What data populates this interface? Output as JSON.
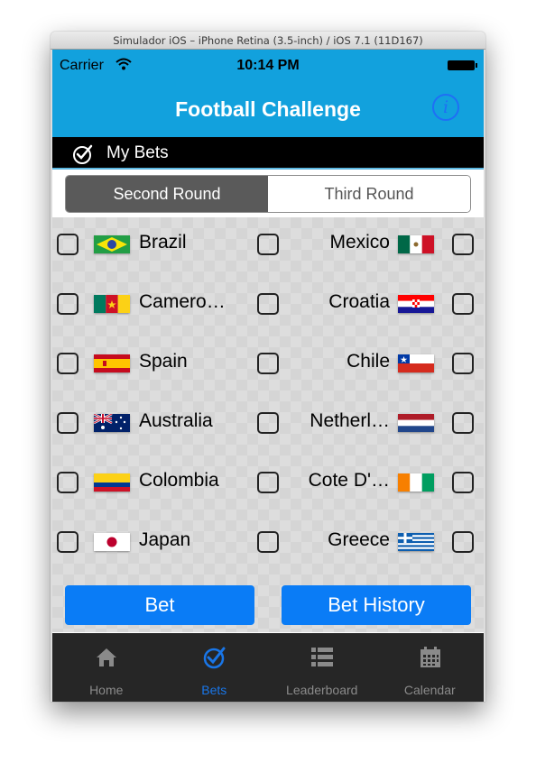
{
  "window": {
    "title": "Simulador iOS – iPhone Retina (3.5-inch) / iOS 7.1 (11D167)"
  },
  "status": {
    "carrier": "Carrier",
    "time": "10:14 PM"
  },
  "nav": {
    "title": "Football Challenge",
    "info_icon": "info-icon"
  },
  "section": {
    "title": "My Bets",
    "icon": "checkmark-circle-icon"
  },
  "rounds": {
    "selected": "Second Round",
    "options": [
      "Second Round",
      "Third Round"
    ]
  },
  "matches": [
    {
      "home": "Brazil",
      "home_flag": "brazil",
      "away": "Mexico",
      "away_flag": "mexico"
    },
    {
      "home": "Camero…",
      "home_flag": "cameroon",
      "away": "Croatia",
      "away_flag": "croatia"
    },
    {
      "home": "Spain",
      "home_flag": "spain",
      "away": "Chile",
      "away_flag": "chile"
    },
    {
      "home": "Australia",
      "home_flag": "australia",
      "away": "Netherl…",
      "away_flag": "netherlands"
    },
    {
      "home": "Colombia",
      "home_flag": "colombia",
      "away": "Cote D'…",
      "away_flag": "ivory-coast"
    },
    {
      "home": "Japan",
      "home_flag": "japan",
      "away": "Greece",
      "away_flag": "greece"
    }
  ],
  "actions": {
    "bet": "Bet",
    "history": "Bet History"
  },
  "tabs": [
    {
      "label": "Home",
      "icon": "home-icon",
      "active": false
    },
    {
      "label": "Bets",
      "icon": "checkmark-circle-icon",
      "active": true
    },
    {
      "label": "Leaderboard",
      "icon": "list-icon",
      "active": false
    },
    {
      "label": "Calendar",
      "icon": "calendar-icon",
      "active": false
    }
  ],
  "colors": {
    "bar": "#12a1dd",
    "accent": "#0a7cf6",
    "tab_active": "#1976e8",
    "tab_inactive": "#8a8a8a",
    "tab_bg": "#262626"
  }
}
